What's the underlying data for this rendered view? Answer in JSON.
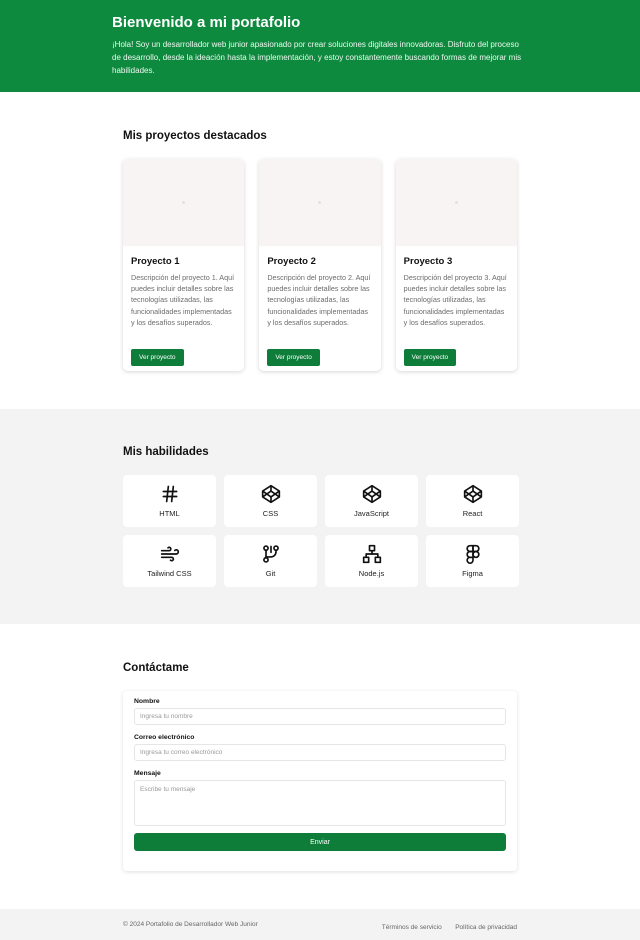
{
  "hero": {
    "title": "Bienvenido a mi portafolio",
    "text": "¡Hola! Soy un desarrollador web junior apasionado por crear soluciones digitales innovadoras. Disfruto del proceso de desarrollo, desde la ideación hasta la implementación, y estoy constantemente buscando formas de mejorar mis habilidades."
  },
  "projects": {
    "title": "Mis proyectos destacados",
    "items": [
      {
        "name": "Proyecto 1",
        "description": "Descripción del proyecto 1. Aquí puedes incluir detalles sobre las tecnologías utilizadas, las funcionalidades implementadas y los desafíos superados.",
        "button": "Ver proyecto"
      },
      {
        "name": "Proyecto 2",
        "description": "Descripción del proyecto 2. Aquí puedes incluir detalles sobre las tecnologías utilizadas, las funcionalidades implementadas y los desafíos superados.",
        "button": "Ver proyecto"
      },
      {
        "name": "Proyecto 3",
        "description": "Descripción del proyecto 3. Aquí puedes incluir detalles sobre las tecnologías utilizadas, las funcionalidades implementadas y los desafíos superados.",
        "button": "Ver proyecto"
      }
    ]
  },
  "skills": {
    "title": "Mis habilidades",
    "items": [
      {
        "name": "HTML",
        "icon": "hash-icon"
      },
      {
        "name": "CSS",
        "icon": "codepen-icon"
      },
      {
        "name": "JavaScript",
        "icon": "codepen-icon"
      },
      {
        "name": "React",
        "icon": "codepen-icon"
      },
      {
        "name": "Tailwind CSS",
        "icon": "wind-icon"
      },
      {
        "name": "Git",
        "icon": "git-branch-icon"
      },
      {
        "name": "Node.js",
        "icon": "sitemap-icon"
      },
      {
        "name": "Figma",
        "icon": "figma-icon"
      }
    ]
  },
  "contact": {
    "title": "Contáctame",
    "name_label": "Nombre",
    "name_placeholder": "Ingresa tu nombre",
    "email_label": "Correo electrónico",
    "email_placeholder": "Ingresa tu correo electrónico",
    "message_label": "Mensaje",
    "message_placeholder": "Escribe tu mensaje",
    "submit": "Enviar"
  },
  "footer": {
    "copyright": "© 2024 Portafolio de Desarrollador Web Junior",
    "terms": "Términos de servicio",
    "privacy": "Política de privacidad"
  },
  "colors": {
    "brand": "#0e8a3e",
    "button": "#0e7d3a",
    "section_bg": "#f3f3f3"
  }
}
